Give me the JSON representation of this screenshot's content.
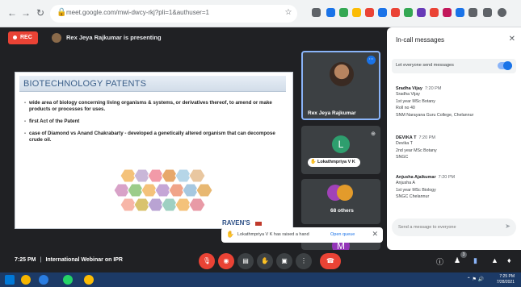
{
  "browser": {
    "url": "meet.google.com/mwi-dwcy-rkj?pli=1&authuser=1",
    "icons": [
      "back-icon",
      "forward-icon",
      "reload-icon",
      "lock-icon",
      "star-icon"
    ]
  },
  "meet": {
    "rec_label": "REC",
    "presenting_label": "Rex Jeya Rajkumar is presenting",
    "slide": {
      "title": "BIOTECHNOLOGY PATENTS",
      "bullets": [
        "wide area of biology concerning living organisms & systems, or derivatives thereof, to amend or make products or processes for uses.",
        "first Act of the Patent",
        "case of Diamond vs Anand Chakrabarty - developed a genetically altered organism that can decompose crude oil."
      ],
      "footer_logo": "RAVEN'S"
    },
    "tiles": [
      {
        "name": "Rex Jeya Rajkumar"
      },
      {
        "initial": "L",
        "name": "Lokathmpriya V K"
      },
      {
        "name": "68 others"
      },
      {
        "initial": "M"
      }
    ],
    "toast": {
      "text": "Lokathmpriya V K has raised a hand",
      "action": "Open queue"
    },
    "controls": {
      "time": "7:25 PM",
      "meeting": "International Webinar on IPR",
      "people_count": "3"
    }
  },
  "chat": {
    "title": "In-call messages",
    "toggle_label": "Let everyone send messages",
    "messages": [
      {
        "sender": "Sradha Vijay",
        "time": "7:20 PM",
        "lines": [
          "Sradha Vijay",
          "1st year MSc Botany",
          "Roll no 40",
          "SNM Narayana Guru College, Chelannur"
        ]
      },
      {
        "sender": "DEVIKA T",
        "time": "7:20 PM",
        "lines": [
          "Devika T",
          "2nd year MSc Botany",
          "SNGC"
        ]
      },
      {
        "sender": "Anjusha Ajaikumar",
        "time": "7:20 PM",
        "lines": [
          "Anjusha A",
          "1st year MSc Biology",
          "SNGC Chelannur"
        ]
      }
    ],
    "composer_placeholder": "Send a message to everyone"
  },
  "taskbar": {
    "time": "7:25 PM",
    "date": "7/28/2021"
  },
  "colors": {
    "accent": "#1a73e8",
    "danger": "#ea4335",
    "stage": "#202124"
  }
}
